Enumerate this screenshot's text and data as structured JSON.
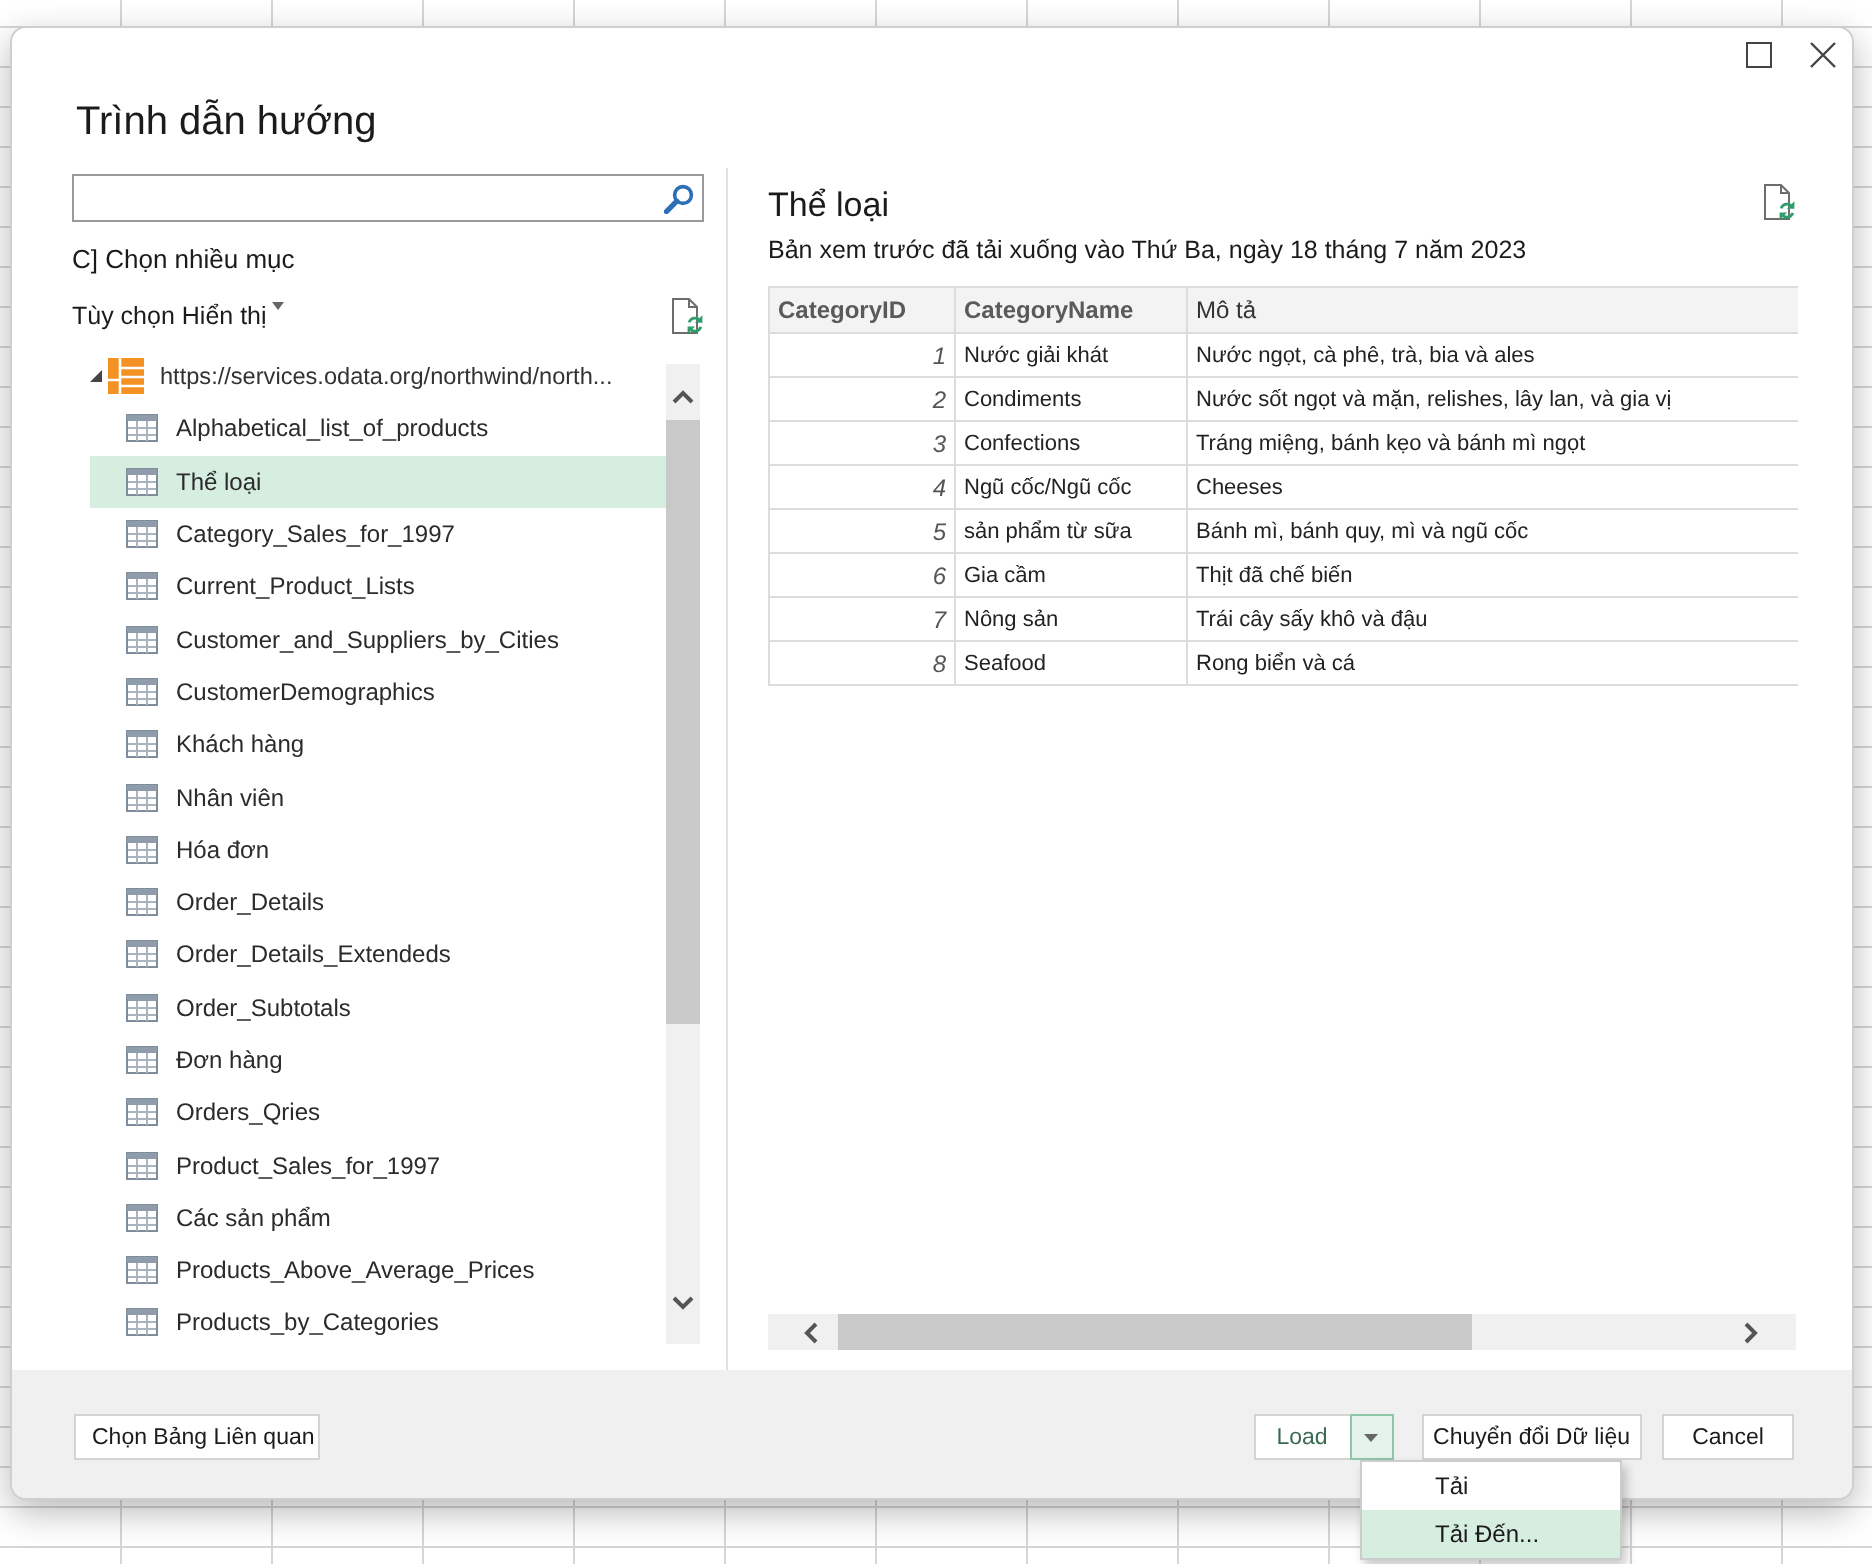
{
  "window": {
    "title": "Trình dẫn hướng"
  },
  "navigator": {
    "multi_select": "C] Chọn nhiều mục",
    "display_options": "Tùy chọn Hiển thị",
    "tree": {
      "label": "https://services.odata.org/northwind/north...",
      "expanded": true,
      "children": [
        {
          "label": "Alphabetical_list_of_products",
          "selected": false
        },
        {
          "label": "Thể loại",
          "selected": true
        },
        {
          "label": "Category_Sales_for_1997",
          "selected": false
        },
        {
          "label": "Current_Product_Lists",
          "selected": false
        },
        {
          "label": "Customer_and_Suppliers_by_Cities",
          "selected": false
        },
        {
          "label": "CustomerDemographics",
          "selected": false
        },
        {
          "label": "Khách hàng",
          "selected": false
        },
        {
          "label": "Nhân viên",
          "selected": false
        },
        {
          "label": "Hóa đơn",
          "selected": false
        },
        {
          "label": "Order_Details",
          "selected": false
        },
        {
          "label": "Order_Details_Extendeds",
          "selected": false
        },
        {
          "label": "Order_Subtotals",
          "selected": false
        },
        {
          "label": "Đơn hàng",
          "selected": false
        },
        {
          "label": "Orders_Qries",
          "selected": false
        },
        {
          "label": "Product_Sales_for_1997",
          "selected": false
        },
        {
          "label": "Các sản phẩm",
          "selected": false
        },
        {
          "label": "Products_Above_Average_Prices",
          "selected": false
        },
        {
          "label": "Products_by_Categories",
          "selected": false
        }
      ]
    }
  },
  "preview": {
    "title": "Thể loại",
    "subtitle": "Bản xem trước đã tải xuống vào Thứ Ba, ngày 18 tháng 7 năm 2023",
    "table": {
      "columns": [
        "CategoryID",
        "CategoryName",
        "Mô tả"
      ],
      "rows": [
        [
          "1",
          "Nước giải khát",
          "Nước ngọt, cà phê, trà, bia và ales"
        ],
        [
          "2",
          "Condiments",
          "Nước sốt ngọt và mặn, relishes, lây lan, và gia vị"
        ],
        [
          "3",
          "Confections",
          "Tráng miệng, bánh kẹo và bánh mì ngọt"
        ],
        [
          "4",
          "Ngũ cốc/Ngũ cốc",
          "Cheeses"
        ],
        [
          "5",
          "sản phẩm từ sữa",
          "Bánh mì, bánh quy, mì và ngũ cốc"
        ],
        [
          "6",
          "Gia cầm",
          "Thịt đã chế biến"
        ],
        [
          "7",
          "Nông sản",
          "Trái cây sấy khô và đậu"
        ],
        [
          "8",
          "Seafood",
          "Rong biển và cá"
        ]
      ]
    }
  },
  "footer": {
    "select_related": "Chọn Bảng Liên quan",
    "load": {
      "label": "Load",
      "menu_open": true,
      "menu": [
        {
          "label": "Tải",
          "selected": false
        },
        {
          "label": "Tải Đến...",
          "selected": true
        }
      ]
    },
    "transform": "Chuyển đổi Dữ liệu",
    "cancel": "Cancel"
  }
}
